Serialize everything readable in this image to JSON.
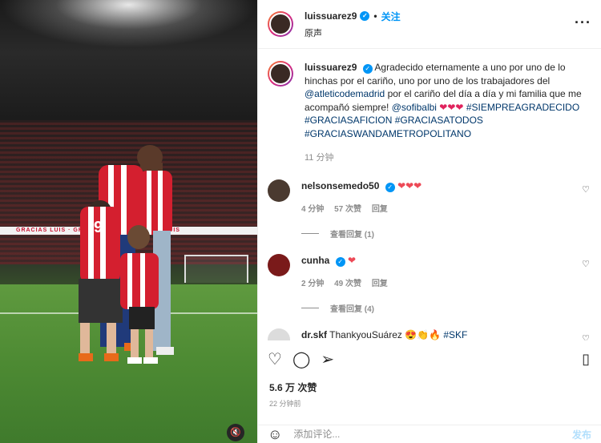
{
  "header": {
    "username": "luissuarez9",
    "verified_icon": "verified-icon",
    "separator": "•",
    "follow_label": "关注",
    "subtitle": "原声",
    "more_icon": "more-icon"
  },
  "caption": {
    "username": "luissuarez9",
    "text_1": "Agradecido eternamente a uno por uno de lo hinchas por el cariño, uno por uno de los trabajadores del ",
    "mention_1": "@atleticodemadrid",
    "text_2": " por el cariño del día a día y mi familia que me acompañó siempre! ",
    "mention_2": "@sofibalbi",
    "hearts": "❤❤❤",
    "hashtags": "#SIEMPREAGRADECIDO #GRACIASAFICION #GRACIASATODOS #GRACIASWANDAMETROPOLITANO",
    "time": "11 分钟"
  },
  "comments": [
    {
      "username": "nelsonsemedo50",
      "text": "❤❤❤",
      "time": "4 分钟",
      "likes": "57 次赞",
      "reply_label": "回复",
      "view_replies": "查看回复 (1)"
    },
    {
      "username": "cunha",
      "text": "❤",
      "time": "2 分钟",
      "likes": "49 次赞",
      "reply_label": "回复",
      "view_replies": "查看回复 (4)"
    },
    {
      "username": "dr.skf",
      "text": "ThankyouSuárez 😍👏🔥",
      "hashtag": "#SKF"
    }
  ],
  "media": {
    "banner_text": "GRACIAS LUIS · GRACIAS LUIS · GRACIAS LUIS",
    "mute_icon": "muted-speaker-icon"
  },
  "actions": {
    "like_icon": "heart-icon",
    "comment_icon": "comment-icon",
    "share_icon": "share-icon",
    "save_icon": "bookmark-icon"
  },
  "likes_count": "5.6 万 次赞",
  "posted_time": "22 分钟前",
  "add_comment": {
    "placeholder": "添加评论...",
    "post_label": "发布",
    "emoji_icon": "emoji-icon"
  },
  "colors": {
    "accent": "#0095f6",
    "heart_red": "#ed4956",
    "link": "#00376b",
    "muted": "#8e8e8e"
  }
}
